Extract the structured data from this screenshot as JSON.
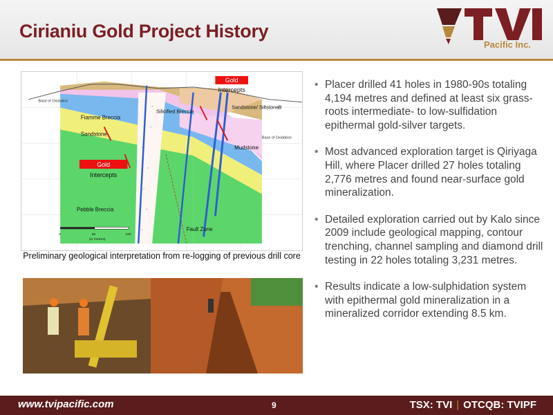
{
  "slide": {
    "title": "Cirianiu Gold Project History",
    "page_number": "9"
  },
  "logo": {
    "mark_letters": "TVI",
    "subtitle": "Pacific Inc.",
    "colors": {
      "dark": "#7b1f24",
      "gold": "#b5893d"
    }
  },
  "diagram": {
    "gold_intercepts_top": {
      "word1": "Gold",
      "word2": "Intercepts"
    },
    "gold_intercepts_left": {
      "word1": "Gold",
      "word2": "Intercepts"
    },
    "labels": {
      "base_oxidation_left": "Base of Oxidation",
      "fiamme_breccia": "Fiamme Breccia",
      "silicified_breccia": "Silicified Breccia",
      "sandstone_siltstone": "Sandstone/ Siltstone",
      "b_marker": "B",
      "base_oxidation_right": "Base of Oxidation",
      "sandstone": "Sandstone",
      "mudstone": "Mudstone",
      "pebble_breccia": "Pebble Breccia",
      "fault_zone": "Fault Zone",
      "scale_0": "0",
      "scale_50": "50",
      "scale_100": "100",
      "scale_units": "(in meters)"
    },
    "caption": "Preliminary geological interpretation from re-logging of previous drill core"
  },
  "bullets": [
    "Placer drilled 41 holes in 1980-90s totaling 4,194 metres and defined at least six grass-roots intermediate- to low-sulfidation epithermal gold-silver targets.",
    "Most advanced exploration target is Qiriyaga Hill, where Placer drilled 27 holes totaling 2,776 metres and found near-surface gold mineralization.",
    "Detailed exploration carried out by Kalo since 2009 include geological mapping, contour trenching, channel sampling and diamond drill testing in 22 holes totaling 3,231 metres.",
    "Results indicate a low-sulphidation system with epithermal gold mineralization in a mineralized corridor extending 8.5 km."
  ],
  "footer": {
    "url": "www.tvipacific.com",
    "ticker_tsx": "TSX: TVI",
    "ticker_otc": "OTCQB: TVIPF"
  }
}
